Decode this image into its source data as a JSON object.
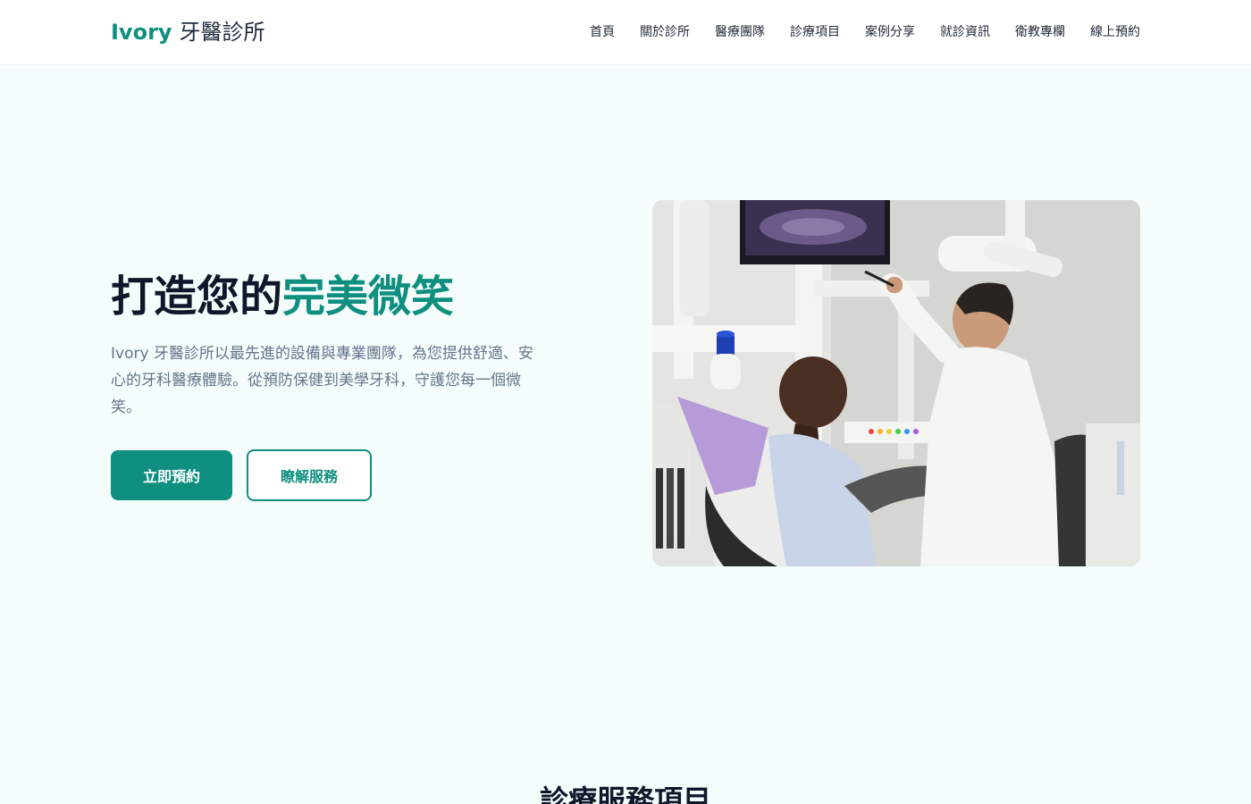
{
  "brand": {
    "name_en": "Ivory",
    "name_zh": "牙醫診所"
  },
  "nav": {
    "items": [
      {
        "label": "首頁"
      },
      {
        "label": "關於診所"
      },
      {
        "label": "醫療團隊"
      },
      {
        "label": "診療項目"
      },
      {
        "label": "案例分享"
      },
      {
        "label": "就診資訊"
      },
      {
        "label": "衛教專欄"
      },
      {
        "label": "線上預約"
      }
    ]
  },
  "hero": {
    "title_main": "打造您的",
    "title_accent": "完美微笑",
    "description": "Ivory 牙醫診所以最先進的設備與專業團隊，為您提供舒適、安心的牙科醫療體驗。從預防保健到美學牙科，守護您每一個微笑。",
    "primary_button": "立即預約",
    "secondary_button": "瞭解服務",
    "image_alt": "牙醫診所"
  },
  "services": {
    "title": "診療服務項目"
  },
  "colors": {
    "accent": "#0f8f80",
    "hero_bg": "#f5fdfc",
    "heading": "#0f172a",
    "body_text": "#64748b"
  }
}
